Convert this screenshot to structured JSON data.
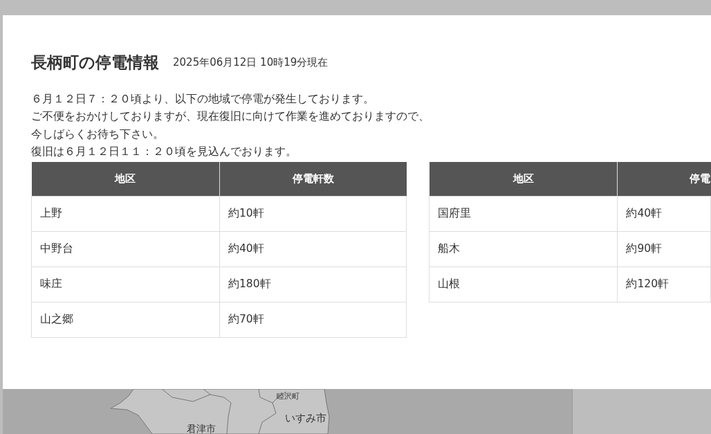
{
  "page": {
    "title": "長柄町の停電情報",
    "timestamp": "2025年06月12日 10時19分現在"
  },
  "notice": [
    "６月１２日７：２０頃より、以下の地域で停電が発生しております。",
    "ご不便をおかけしておりますが、現在復旧に向けて作業を進めておりますので、",
    "今しばらくお待ち下さい。",
    "復旧は６月１２日１１：２０頃を見込んでおります。"
  ],
  "tables": [
    {
      "columns": [
        "地区",
        "停電軒数"
      ],
      "rows": [
        [
          "上野",
          "約10軒"
        ],
        [
          "中野台",
          "約40軒"
        ],
        [
          "味庄",
          "約180軒"
        ],
        [
          "山之郷",
          "約70軒"
        ]
      ]
    },
    {
      "columns": [
        "地区",
        "停電"
      ],
      "rows": [
        [
          "国府里",
          "約40軒"
        ],
        [
          "船木",
          "約90軒"
        ],
        [
          "山根",
          "約120軒"
        ]
      ]
    }
  ],
  "map": {
    "labels": [
      "睦沢町",
      "いすみ市",
      "君津市"
    ]
  }
}
